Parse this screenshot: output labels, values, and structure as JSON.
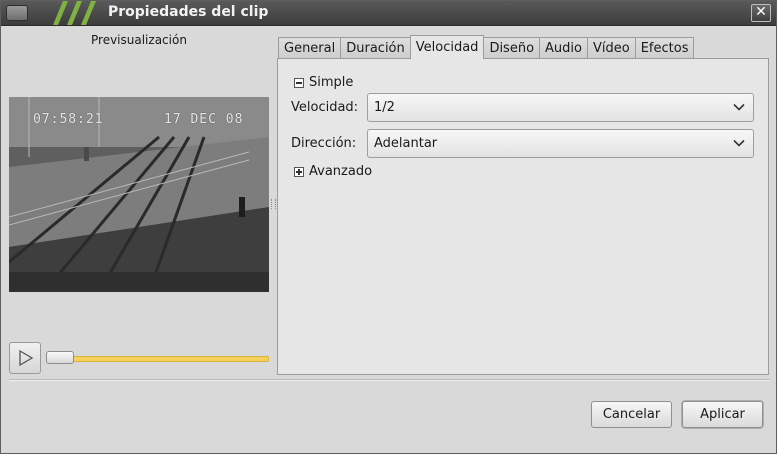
{
  "window": {
    "title": "Propiedades del clip"
  },
  "preview": {
    "label": "Previsualización",
    "overlay_time": "07:58:21",
    "overlay_date": "17 DEC 08",
    "play_icon": "play-icon"
  },
  "tabs": [
    {
      "label": "General"
    },
    {
      "label": "Duración"
    },
    {
      "label": "Velocidad",
      "active": true
    },
    {
      "label": "Diseño"
    },
    {
      "label": "Audio"
    },
    {
      "label": "Vídeo"
    },
    {
      "label": "Efectos"
    }
  ],
  "speed_tab": {
    "simple_label": "Simple",
    "speed_label": "Velocidad:",
    "speed_value": "1/2",
    "direction_label": "Dirección:",
    "direction_value": "Adelantar",
    "advanced_label": "Avanzado"
  },
  "buttons": {
    "cancel": "Cancelar",
    "apply": "Aplicar"
  },
  "colors": {
    "titlebar": "#3c3c3c",
    "stripe": "#7fb241",
    "slider": "#f5d35a"
  }
}
